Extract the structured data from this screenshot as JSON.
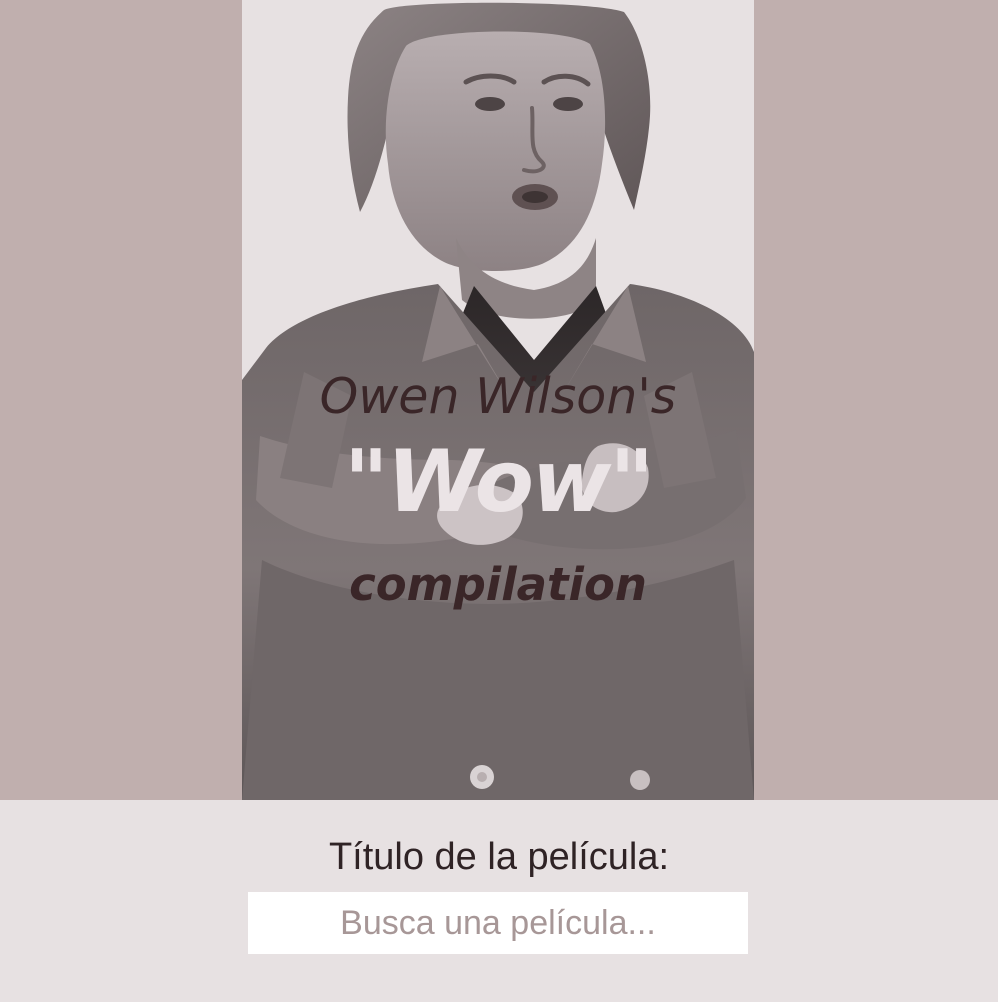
{
  "hero": {
    "title_line_1": "Owen Wilson's",
    "title_line_2": "\"Wow\"",
    "title_line_3": "compilation"
  },
  "search": {
    "label": "Título de la película:",
    "placeholder": "Busca una película...",
    "value": ""
  },
  "colors": {
    "side_background": "#c0afae",
    "panel_background": "#e7e1e2",
    "title_dark": "#3a2628",
    "title_light": "#ebe4e6",
    "input_background": "#ffffff",
    "placeholder": "#a79797"
  },
  "icons": {
    "hero_image": "portrait-photo"
  }
}
